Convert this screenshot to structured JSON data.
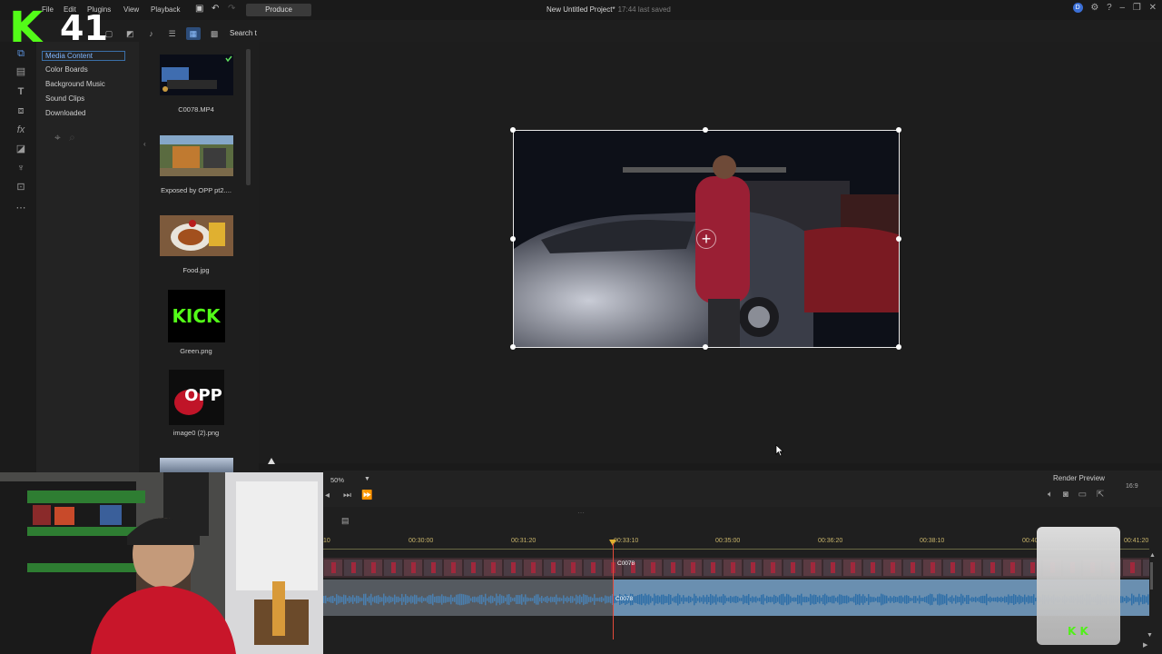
{
  "menu": {
    "items": [
      "File",
      "Edit",
      "Plugins",
      "View",
      "Playback"
    ],
    "produce": "Produce"
  },
  "window": {
    "title": "New Untitled Project*",
    "saved": "17:44 last saved"
  },
  "overlay_logo": {
    "letter": "K",
    "number": "41"
  },
  "toolbar": {
    "search": "Search t"
  },
  "categories": [
    "Media Content",
    "Color Boards",
    "Background Music",
    "Sound Clips",
    "Downloaded"
  ],
  "media": [
    {
      "name": "C0078.MP4"
    },
    {
      "name": "Exposed by OPP pt2...."
    },
    {
      "name": "Food.jpg"
    },
    {
      "name": "Green.png",
      "thumb_text": "KICK"
    },
    {
      "name": "image0 (2).png",
      "thumb_text": "OPP"
    }
  ],
  "preview": {
    "zoom": "50%"
  },
  "render_preview": "Render Preview",
  "aspect": "16:9",
  "timeline": {
    "ticks": [
      "00:30:00",
      "00:31:20",
      "00:33:10",
      "00:35:00",
      "00:36:20",
      "00:38:10",
      "00:40",
      "00:41:20"
    ],
    "ruler_start": "10",
    "clip_label": "C0078",
    "clip_label_audio": "C0078"
  },
  "colors": {
    "kick_green": "#53fc18",
    "playhead": "#e24a3a",
    "audio_wave": "#4a9bd8"
  }
}
